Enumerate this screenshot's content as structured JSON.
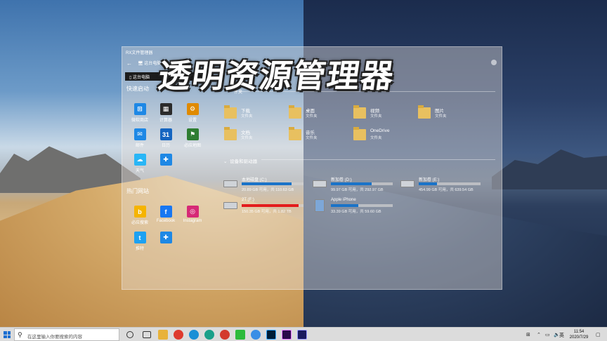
{
  "window": {
    "title": "RX文件管理器",
    "address": "这台电脑",
    "selected_item": "这台电脑",
    "overlay_title": "透明资源管理器",
    "header_fragment": "件夹"
  },
  "sidebar": {
    "quick_start_label": "快速启动",
    "quick_apps": [
      {
        "label": "微软商店",
        "icon": "store-icon",
        "color": "#1e88e5"
      },
      {
        "label": "计算器",
        "icon": "calculator-icon",
        "color": "#2b2b2b"
      },
      {
        "label": "设置",
        "icon": "gear-icon",
        "color": "#e08a00"
      },
      {
        "label": "邮件",
        "icon": "mail-icon",
        "color": "#1e88e5"
      },
      {
        "label": "日历",
        "icon": "calendar-icon",
        "color": "#1565c0"
      },
      {
        "label": "必应地图",
        "icon": "map-icon",
        "color": "#2e7d32"
      },
      {
        "label": "天气",
        "icon": "weather-icon",
        "color": "#29b6f6"
      },
      {
        "label": "",
        "icon": "add-icon",
        "color": "#1e88e5"
      }
    ],
    "hot_sites_label": "热门网站",
    "sites": [
      {
        "label": "必应搜索",
        "icon": "bing-icon",
        "color": "#f5b400"
      },
      {
        "label": "Facebook",
        "icon": "facebook-icon",
        "color": "#1877f2"
      },
      {
        "label": "Instagram",
        "icon": "instagram-icon",
        "color": "#d62976"
      },
      {
        "label": "推特",
        "icon": "twitter-icon",
        "color": "#1da1f2"
      },
      {
        "label": "",
        "icon": "add-icon",
        "color": "#1e88e5"
      }
    ]
  },
  "folders": [
    {
      "name": "下载",
      "sub": "文件夹"
    },
    {
      "name": "桌面",
      "sub": "文件夹"
    },
    {
      "name": "视频",
      "sub": "文件夹"
    },
    {
      "name": "图片",
      "sub": "文件夹"
    },
    {
      "name": "文档",
      "sub": "文件夹"
    },
    {
      "name": "音乐",
      "sub": "文件夹"
    },
    {
      "name": "OneDrive",
      "sub": "文件夹"
    }
  ],
  "devices_group_label": "设备和驱动器",
  "drives": [
    {
      "name": "本地磁盘 (C:)",
      "info": "20.89 GB 可用，共 110.63 GB",
      "used": 0.81,
      "color": "#1a73c8"
    },
    {
      "name": "新加卷 (D:)",
      "info": "99.97 GB 可用，共 292.97 GB",
      "used": 0.66,
      "color": "#1a73c8"
    },
    {
      "name": "新加卷 (E:)",
      "info": "454.99 GB 可用，共 639.54 GB",
      "used": 0.29,
      "color": "#1a73c8"
    },
    {
      "name": "2T (F:)",
      "info": "150.35 GB 可用，共 1.82 TB",
      "used": 0.92,
      "color": "#e31c1c"
    },
    {
      "name": "Apple iPhone",
      "info": "33.39 GB 可用，共 59.60 GB",
      "used": 0.44,
      "color": "#1a73c8"
    }
  ],
  "taskbar": {
    "search_placeholder": "在这里输入你要搜索的内容",
    "time": "11:54",
    "date": "2020/7/29",
    "ime": "英"
  }
}
